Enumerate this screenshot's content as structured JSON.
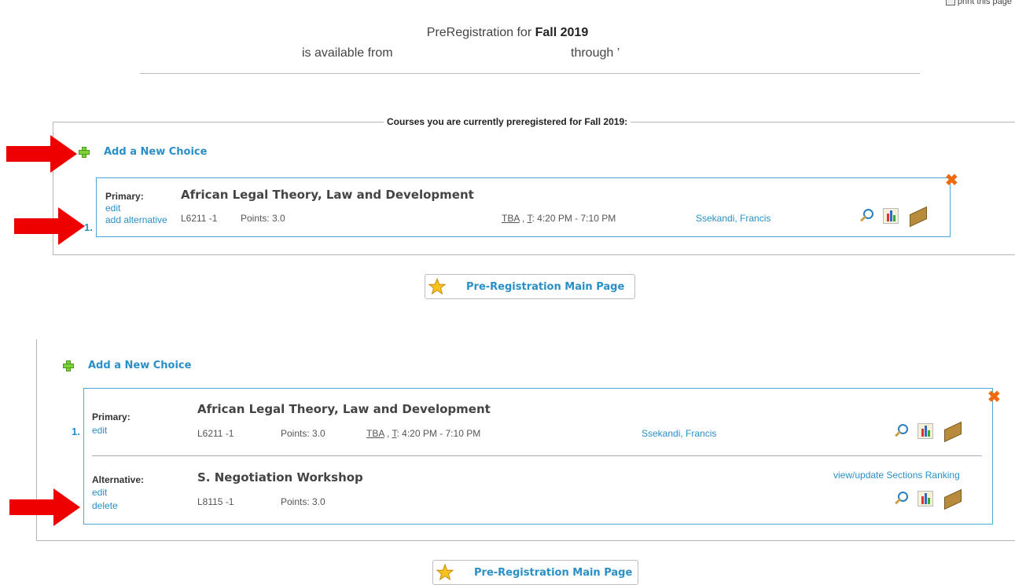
{
  "header": {
    "print_label": "print this page",
    "prereg_label": "PreRegistration for",
    "term": "Fall 2019",
    "available_from": "is available from",
    "through": "through ’"
  },
  "section1": {
    "legend": "Courses you are currently preregistered for Fall 2019:",
    "add_choice": "Add a New Choice",
    "choice_number": "1.",
    "primary": {
      "label": "Primary:",
      "edit": "edit",
      "add_alternative": "add alternative",
      "title": "African Legal Theory, Law and Development",
      "code": "L6211 -1",
      "points": "Points: 3.0",
      "room": "TBA",
      "sep": " , ",
      "day": "T",
      "time": ": 4:20 PM - 7:10 PM",
      "instructor": "Ssekandi, Francis"
    },
    "main_page_button": "Pre-Registration Main Page"
  },
  "section2": {
    "add_choice": "Add a New Choice",
    "choice_number": "1.",
    "primary": {
      "label": "Primary:",
      "edit": "edit",
      "title": "African Legal Theory, Law and Development",
      "code": "L6211 -1",
      "points": "Points: 3.0",
      "room": "TBA",
      "sep": " , ",
      "day": "T",
      "time": ": 4:20 PM - 7:10 PM",
      "instructor": "Ssekandi, Francis"
    },
    "alternative": {
      "label": "Alternative:",
      "edit": "edit",
      "delete": "delete",
      "title": "S. Negotiation Workshop",
      "code": "L8115 -1",
      "points": "Points: 3.0",
      "ranking_link": "view/update Sections Ranking"
    },
    "main_page_button": "Pre-Registration Main Page"
  },
  "colors": {
    "link": "#2a8fc7",
    "arrow": "#ee0000",
    "card_border": "#4aa9d6",
    "delete_x": "#f06a10"
  },
  "icons": [
    "plus-icon",
    "close-icon",
    "magnifier-icon",
    "chart-icon",
    "book-icon",
    "star-icon",
    "arrow-icon",
    "printer-icon"
  ]
}
